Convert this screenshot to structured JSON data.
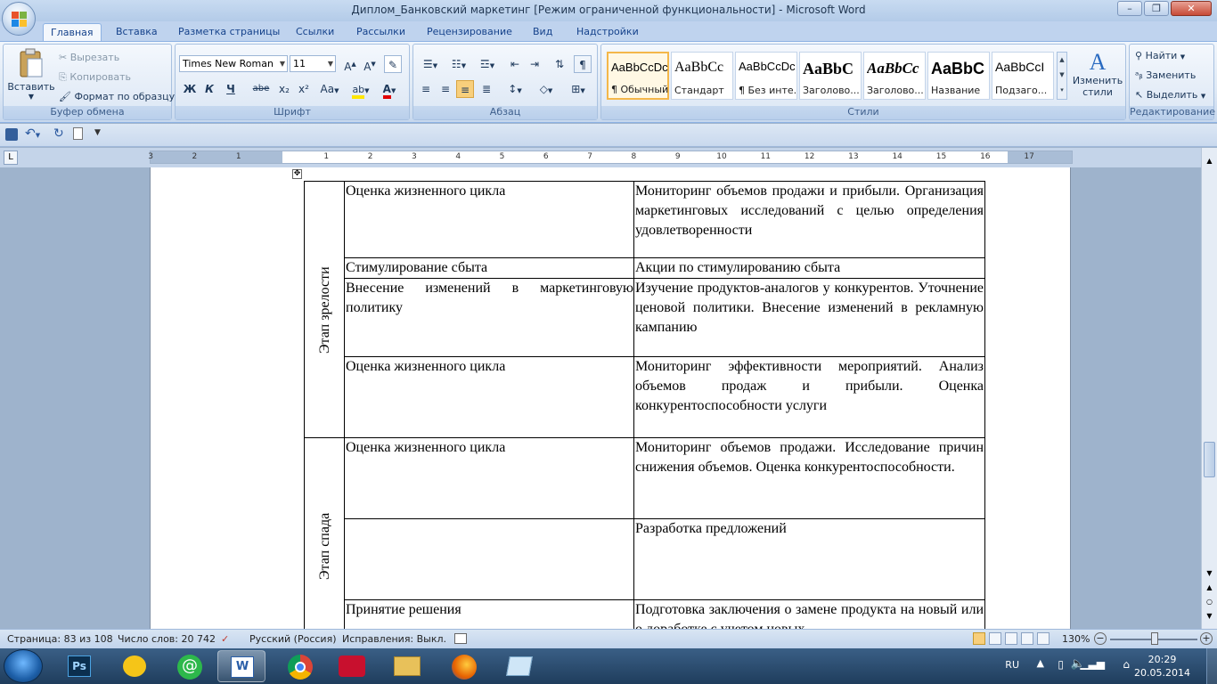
{
  "window": {
    "title": "Диплом_Банковский маркетинг [Режим ограниченной функциональности] - Microsoft Word"
  },
  "tabs": [
    "Главная",
    "Вставка",
    "Разметка страницы",
    "Ссылки",
    "Рассылки",
    "Рецензирование",
    "Вид",
    "Надстройки"
  ],
  "clipboard": {
    "paste": "Вставить",
    "cut": "Вырезать",
    "copy": "Копировать",
    "format_painter": "Формат по образцу",
    "label": "Буфер обмена"
  },
  "font": {
    "name": "Times New Roman",
    "size": "11",
    "label": "Шрифт",
    "bold": "Ж",
    "italic": "К",
    "underline": "Ч",
    "strike": "abe",
    "sub": "x₂",
    "sup": "x²",
    "case": "Aa"
  },
  "paragraph": {
    "label": "Абзац"
  },
  "styles": {
    "label": "Стили",
    "items": [
      {
        "sample": "AaBbCcDc",
        "name": "¶ Обычный"
      },
      {
        "sample": "AaBbCc",
        "name": "Стандарт"
      },
      {
        "sample": "AaBbCcDc",
        "name": "¶ Без инте..."
      },
      {
        "sample": "AaBbC",
        "name": "Заголово..."
      },
      {
        "sample": "AaBbCc",
        "name": "Заголово..."
      },
      {
        "sample": "AaBbC",
        "name": "Название"
      },
      {
        "sample": "AaBbCcI",
        "name": "Подзаго..."
      }
    ],
    "change": "Изменить стили"
  },
  "editing": {
    "find": "Найти",
    "replace": "Заменить",
    "select": "Выделить",
    "label": "Редактирование"
  },
  "table": {
    "stages": [
      "Этап зрелости",
      "Этап спада"
    ],
    "rows": [
      {
        "c1": "Оценка жизненного цикла",
        "c2": "Мониторинг объемов продажи и прибыли. Организация маркетинговых исследований с целью определения удовлетворенности"
      },
      {
        "c1": "Стимулирование сбыта",
        "c2": "Акции по стимулированию сбыта"
      },
      {
        "c1": "Внесение изменений в маркетинговую политику",
        "c2": "Изучение продуктов-аналогов у конкурентов. Уточнение ценовой политики. Внесение изменений в рекламную кампанию"
      },
      {
        "c1": "Оценка жизненного цикла",
        "c2": "Мониторинг эффективности мероприятий. Анализ объемов продаж и прибыли. Оценка конкурентоспособности услуги"
      },
      {
        "c1": "Оценка жизненного цикла",
        "c2": "Мониторинг объемов продажи. Исследование причин снижения объемов. Оценка конкурентоспособности."
      },
      {
        "c1": "",
        "c2": "Разработка предложений"
      },
      {
        "c1": "Принятие решения",
        "c2": "Подготовка заключения о замене продукта на новый или о доработке с учетом новых"
      }
    ]
  },
  "status": {
    "page": "Страница: 83 из 108",
    "words": "Число слов: 20 742",
    "lang": "Русский (Россия)",
    "track": "Исправления: Выкл.",
    "zoom": "130%"
  },
  "tray": {
    "lang": "RU",
    "time": "20:29",
    "date": "20.05.2014"
  }
}
